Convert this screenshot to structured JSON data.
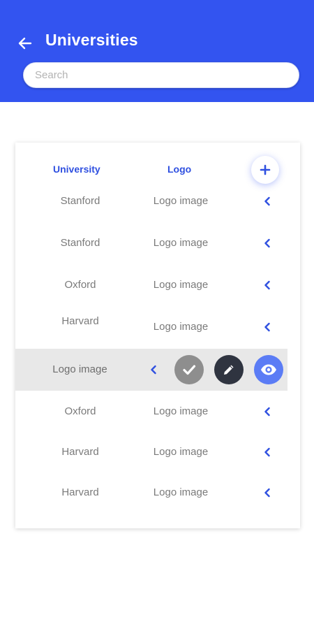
{
  "header": {
    "title": "Universities",
    "back_icon": "arrow-left-icon",
    "background_color": "#3354f0"
  },
  "search": {
    "placeholder": "Search",
    "value": ""
  },
  "table": {
    "columns": [
      "University",
      "Logo"
    ],
    "add_icon": "plus-icon",
    "rows": [
      {
        "university": "Stanford",
        "logo": "Logo image"
      },
      {
        "university": "Stanford",
        "logo": "Logo image"
      },
      {
        "university": "Oxford",
        "logo": "Logo image"
      },
      {
        "university": "Harvard",
        "logo": "Logo image"
      },
      {
        "logo": "Logo image",
        "expanded": true,
        "actions": [
          "check-icon",
          "pencil-icon",
          "eye-icon"
        ]
      },
      {
        "university": "Oxford",
        "logo": "Logo image"
      },
      {
        "university": "Harvard",
        "logo": "Logo image"
      },
      {
        "university": "Harvard",
        "logo": "Logo image"
      }
    ]
  },
  "colors": {
    "accent": "#2f50e0",
    "approve": "#8e8e8e",
    "edit": "#2f3440",
    "view": "#5b7cf5",
    "expanded_row": "#e8e8e8"
  }
}
